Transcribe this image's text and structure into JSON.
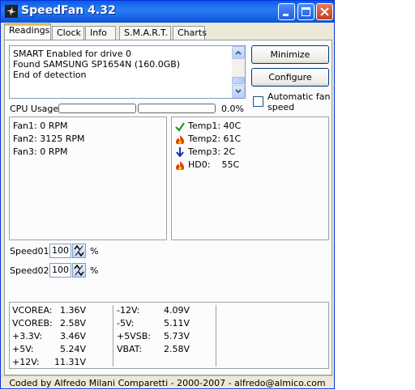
{
  "window": {
    "title": "SpeedFan 4.32",
    "icon": "fan-icon",
    "controls": [
      "minimize-icon",
      "maximize-icon",
      "close-icon"
    ]
  },
  "tabs": [
    {
      "label": "Readings",
      "active": true
    },
    {
      "label": "Clock",
      "active": false
    },
    {
      "label": "Info",
      "active": false
    },
    {
      "label": "S.M.A.R.T.",
      "active": false
    },
    {
      "label": "Charts",
      "active": false
    }
  ],
  "log": {
    "lines": [
      "SMART Enabled for drive 0",
      "Found SAMSUNG SP1654N (160.0GB)",
      "End of detection"
    ]
  },
  "buttons": {
    "minimize": "Minimize",
    "configure": "Configure"
  },
  "auto_fan": {
    "label": "Automatic fan speed",
    "checked": false
  },
  "cpu_usage": {
    "label": "CPU Usage",
    "value": "0.0%",
    "bars": [
      0,
      0
    ]
  },
  "fans": [
    "Fan1: 0 RPM",
    "Fan2: 3125 RPM",
    "Fan3: 0 RPM"
  ],
  "temps": [
    {
      "label": "Temp1:",
      "value": "40C",
      "status_icon": "check-icon",
      "color": "#1a9a1a"
    },
    {
      "label": "Temp2:",
      "value": "61C",
      "status_icon": "flame-icon",
      "color": "#e03c00"
    },
    {
      "label": "Temp3:",
      "value": "2C",
      "status_icon": "arrow-down-icon",
      "color": "#1030c0"
    },
    {
      "label": "HD0:",
      "value": "55C",
      "status_icon": "flame-icon",
      "color": "#e03c00"
    }
  ],
  "speeds": [
    {
      "label": "Speed01:",
      "value": "100",
      "unit": "%"
    },
    {
      "label": "Speed02:",
      "value": "100",
      "unit": "%"
    }
  ],
  "voltages": {
    "col1": [
      {
        "label": "VCOREA:",
        "value": "1.36V"
      },
      {
        "label": "VCOREB:",
        "value": "2.58V"
      },
      {
        "label": "+3.3V:",
        "value": "3.46V"
      },
      {
        "label": "+5V:",
        "value": "5.24V"
      },
      {
        "label": "+12V:",
        "value": "11.31V"
      }
    ],
    "col2": [
      {
        "label": "-12V:",
        "value": "4.09V"
      },
      {
        "label": "-5V:",
        "value": "5.11V"
      },
      {
        "label": "+5VSB:",
        "value": "5.73V"
      },
      {
        "label": "VBAT:",
        "value": "2.58V"
      }
    ]
  },
  "status": "Coded by Alfredo Milani Comparetti - 2000-2007 - alfredo@almico.com"
}
